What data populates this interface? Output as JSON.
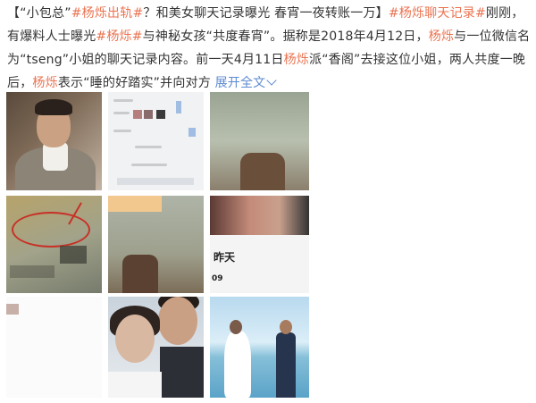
{
  "post": {
    "p1": "【“小包总”",
    "tag1": "#杨烁出轨#",
    "p2": "？和美女聊天记录曝光 春宵一夜转账一万】",
    "tag2": "#杨烁聊天记录#",
    "p3": "刚刚，有爆料人士曝光",
    "tag3": "#杨烁#",
    "p4": "与神秘女孩“共度春宵”。据称是2018年4月12日，",
    "tag4": "杨烁",
    "p5": "与一位微信名为“tseng”小姐的聊天记录内容。前一天4月11日",
    "tag5": "杨烁",
    "p6": "派“香阁”去接这位小姐，两人共度一晚后，",
    "tag6": "杨烁",
    "p7": "表示“睡的好踏实”并向对方",
    "expand_label": "展开全文"
  },
  "images": {
    "p6_big_text": "昨天",
    "p6_num": "09"
  }
}
